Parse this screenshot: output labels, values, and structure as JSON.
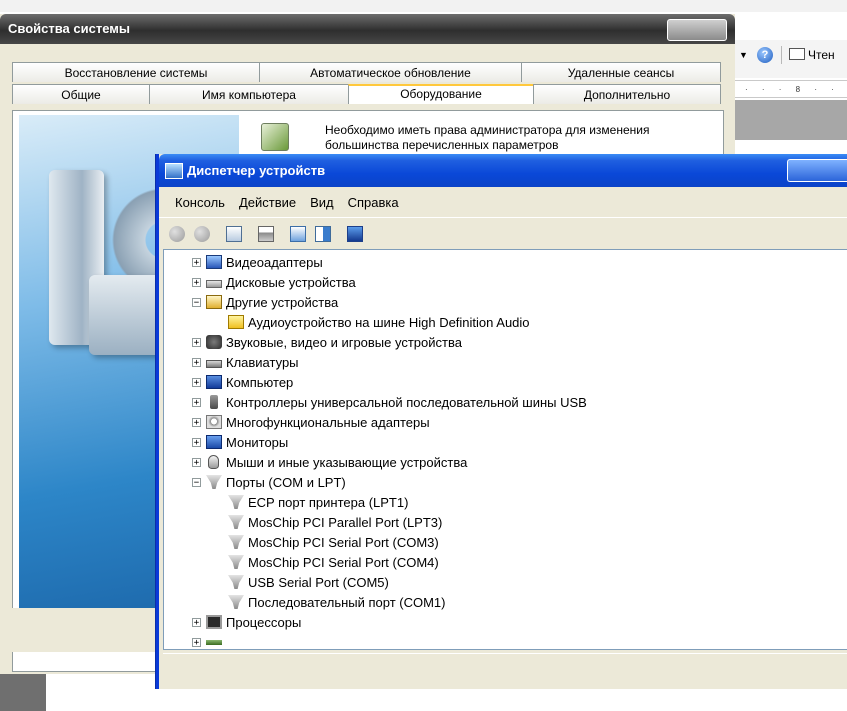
{
  "background_app": {
    "toolbar_read_label": "Чтен",
    "ruler_text": "·  ·  ·  8  ·  ·"
  },
  "system_properties": {
    "title": "Свойства системы",
    "tabs_row1": [
      "Восстановление системы",
      "Автоматическое обновление",
      "Удаленные сеансы"
    ],
    "tabs_row2": [
      "Общие",
      "Имя компьютера",
      "Оборудование",
      "Дополнительно"
    ],
    "active_tab": "Оборудование",
    "hardware_text": "Необходимо иметь права администратора для изменения большинства перечисленных параметров"
  },
  "device_manager": {
    "title": "Диспетчер устройств",
    "menu": [
      "Консоль",
      "Действие",
      "Вид",
      "Справка"
    ],
    "toolbar_icons": [
      "back-icon",
      "forward-icon",
      "properties-icon",
      "print-icon",
      "help-icon",
      "update-driver-icon",
      "scan-hardware-icon"
    ],
    "tree": [
      {
        "label": "Видеоадаптеры",
        "level": 0,
        "expander": "+",
        "icon": "display-adapter-icon"
      },
      {
        "label": "Дисковые устройства",
        "level": 0,
        "expander": "+",
        "icon": "disk-drive-icon"
      },
      {
        "label": "Другие устройства",
        "level": 0,
        "expander": "−",
        "icon": "other-devices-icon"
      },
      {
        "label": "Аудиоустройство на шине High Definition Audio",
        "level": 1,
        "expander": "",
        "icon": "warning-device-icon"
      },
      {
        "label": "Звуковые, видео и игровые устройства",
        "level": 0,
        "expander": "+",
        "icon": "sound-video-icon"
      },
      {
        "label": "Клавиатуры",
        "level": 0,
        "expander": "+",
        "icon": "keyboard-icon"
      },
      {
        "label": "Компьютер",
        "level": 0,
        "expander": "+",
        "icon": "computer-icon"
      },
      {
        "label": "Контроллеры универсальной последовательной шины USB",
        "level": 0,
        "expander": "+",
        "icon": "usb-controller-icon"
      },
      {
        "label": "Многофункциональные адаптеры",
        "level": 0,
        "expander": "+",
        "icon": "multifunction-adapter-icon"
      },
      {
        "label": "Мониторы",
        "level": 0,
        "expander": "+",
        "icon": "monitor-icon"
      },
      {
        "label": "Мыши и иные указывающие устройства",
        "level": 0,
        "expander": "+",
        "icon": "mouse-icon"
      },
      {
        "label": "Порты (COM и LPT)",
        "level": 0,
        "expander": "−",
        "icon": "port-icon"
      },
      {
        "label": "ECP порт принтера (LPT1)",
        "level": 1,
        "expander": "",
        "icon": "port-icon"
      },
      {
        "label": "MosChip PCI Parallel Port (LPT3)",
        "level": 1,
        "expander": "",
        "icon": "port-icon"
      },
      {
        "label": "MosChip PCI Serial Port (COM3)",
        "level": 1,
        "expander": "",
        "icon": "port-icon"
      },
      {
        "label": "MosChip PCI Serial Port (COM4)",
        "level": 1,
        "expander": "",
        "icon": "port-icon"
      },
      {
        "label": "USB Serial Port (COM5)",
        "level": 1,
        "expander": "",
        "icon": "port-icon"
      },
      {
        "label": "Последовательный порт (COM1)",
        "level": 1,
        "expander": "",
        "icon": "port-icon"
      },
      {
        "label": "Процессоры",
        "level": 0,
        "expander": "+",
        "icon": "processor-icon"
      },
      {
        "label": "",
        "level": 0,
        "expander": "+",
        "icon": "system-device-icon"
      }
    ]
  }
}
